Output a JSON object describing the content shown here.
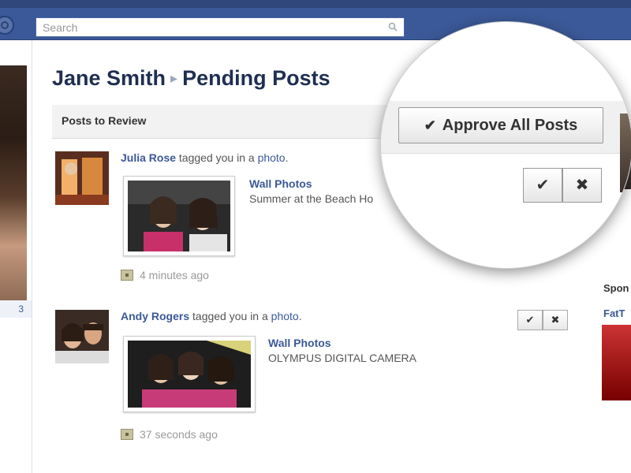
{
  "search": {
    "placeholder": "Search"
  },
  "page": {
    "owner": "Jane Smith",
    "section": "Pending Posts"
  },
  "review_bar": {
    "label": "Posts to Review"
  },
  "sidebar": {
    "count": "3"
  },
  "posts": [
    {
      "author": "Julia Rose",
      "action_text": "tagged you in a",
      "object": "photo",
      "album": "Wall Photos",
      "caption": "Summer at the Beach Ho",
      "time": "4 minutes ago"
    },
    {
      "author": "Andy Rogers",
      "action_text": "tagged you in a",
      "object": "photo",
      "album": "Wall Photos",
      "caption": "OLYMPUS DIGITAL CAMERA",
      "time": "37 seconds ago"
    }
  ],
  "actions": {
    "approve_all": "Approve All Posts",
    "approve_icon": "check-icon",
    "reject_icon": "close-icon"
  },
  "right_column": {
    "sponsored": "Spon",
    "link": "FatT"
  },
  "colors": {
    "header": "#3b5998",
    "link": "#3b5998",
    "title": "#1f2e52"
  }
}
